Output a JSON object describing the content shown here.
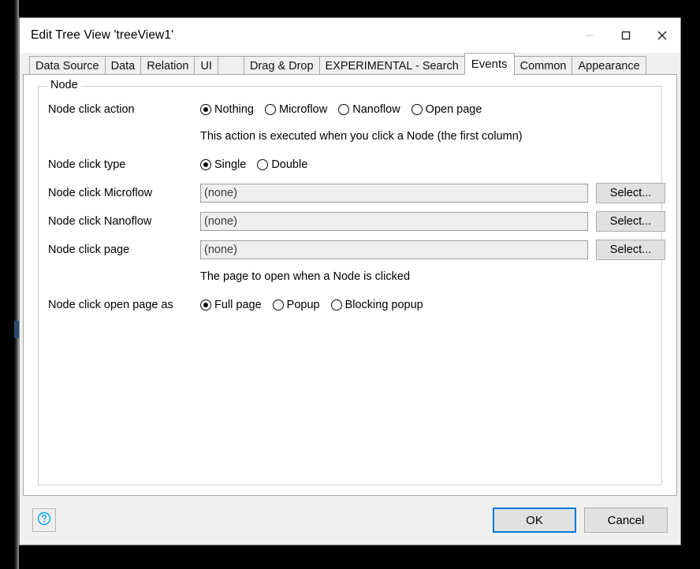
{
  "window": {
    "title": "Edit Tree View 'treeView1'",
    "controls": {
      "minimize": "minimize-icon",
      "maximize": "maximize-icon",
      "close": "close-icon"
    }
  },
  "tabs": [
    {
      "label": "Data Source",
      "selected": false
    },
    {
      "label": "Data",
      "selected": false
    },
    {
      "label": "Relation",
      "selected": false
    },
    {
      "label": "UI",
      "selected": false
    },
    {
      "label": "",
      "selected": false
    },
    {
      "label": "Drag & Drop",
      "selected": false
    },
    {
      "label": "EXPERIMENTAL - Search",
      "selected": false
    },
    {
      "label": "Events",
      "selected": true
    },
    {
      "label": "Common",
      "selected": false
    },
    {
      "label": "Appearance",
      "selected": false
    }
  ],
  "group": {
    "legend": "Node"
  },
  "form": {
    "node_click_action": {
      "label": "Node click action",
      "options": [
        {
          "label": "Nothing",
          "selected": true
        },
        {
          "label": "Microflow",
          "selected": false
        },
        {
          "label": "Nanoflow",
          "selected": false
        },
        {
          "label": "Open page",
          "selected": false
        }
      ],
      "hint": "This action is executed when you click a Node (the first column)"
    },
    "node_click_type": {
      "label": "Node click type",
      "options": [
        {
          "label": "Single",
          "selected": true
        },
        {
          "label": "Double",
          "selected": false
        }
      ]
    },
    "node_click_microflow": {
      "label": "Node click Microflow",
      "value": "(none)",
      "button": "Select..."
    },
    "node_click_nanoflow": {
      "label": "Node click Nanoflow",
      "value": "(none)",
      "button": "Select..."
    },
    "node_click_page": {
      "label": "Node click page",
      "value": "(none)",
      "button": "Select...",
      "hint": "The page to open when a Node is clicked"
    },
    "node_click_open_page_as": {
      "label": "Node click open page as",
      "options": [
        {
          "label": "Full page",
          "selected": true
        },
        {
          "label": "Popup",
          "selected": false
        },
        {
          "label": "Blocking popup",
          "selected": false
        }
      ]
    }
  },
  "footer": {
    "help": "help-icon",
    "ok": "OK",
    "cancel": "Cancel"
  },
  "colors": {
    "accent": "#0078d7",
    "help_icon": "#00a2e8",
    "dialog_bg": "#f0f0f0",
    "panel_bg": "#ffffff",
    "field_bg": "#efefef"
  }
}
